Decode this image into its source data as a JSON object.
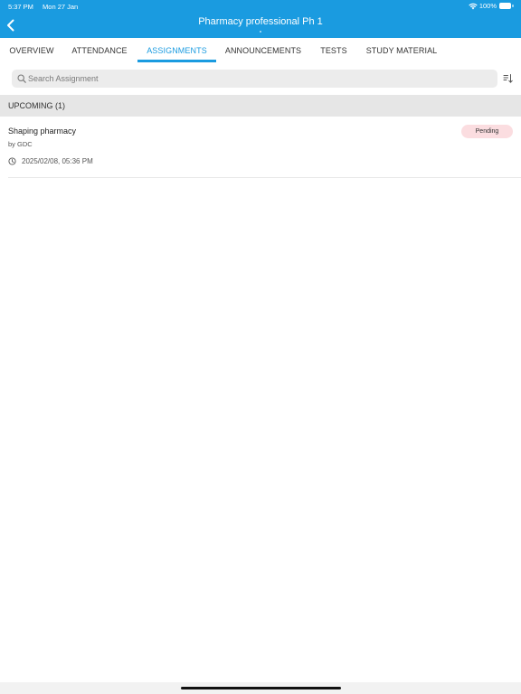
{
  "status_bar": {
    "time": "5:37 PM",
    "date": "Mon 27 Jan",
    "battery": "100%"
  },
  "nav": {
    "title": "Pharmacy professional Ph 1",
    "back_icon": "chevron-left-icon"
  },
  "tabs": [
    {
      "label": "OVERVIEW",
      "active": false
    },
    {
      "label": "ATTENDANCE",
      "active": false
    },
    {
      "label": "ASSIGNMENTS",
      "active": true
    },
    {
      "label": "ANNOUNCEMENTS",
      "active": false
    },
    {
      "label": "TESTS",
      "active": false
    },
    {
      "label": "STUDY MATERIAL",
      "active": false
    }
  ],
  "search": {
    "placeholder": "Search Assignment",
    "value": ""
  },
  "section": {
    "title": "UPCOMING (1)"
  },
  "assignments": [
    {
      "title": "Shaping pharmacy",
      "author": "by GDC",
      "due": "2025/02/08, 05:36 PM",
      "status": "Pending"
    }
  ],
  "colors": {
    "brand": "#1a9be0",
    "pending_badge_bg": "#fbdde0",
    "section_bg": "#e6e6e6"
  }
}
